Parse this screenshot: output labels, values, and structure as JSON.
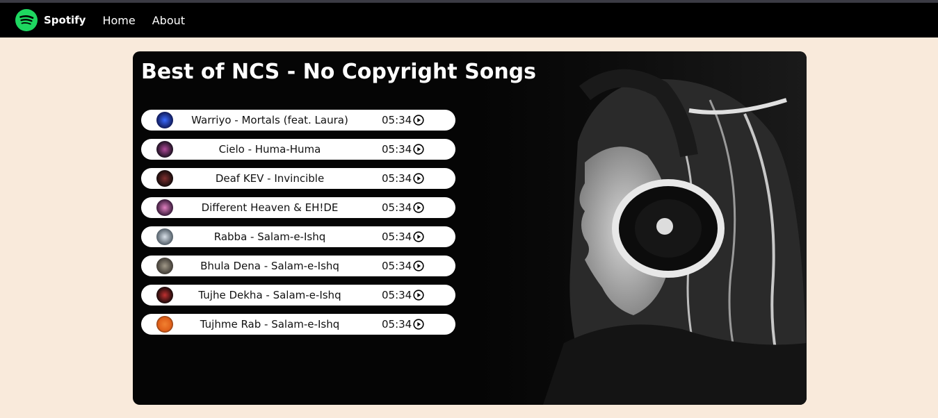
{
  "nav": {
    "brand": "Spotify",
    "links": [
      "Home",
      "About"
    ],
    "accent": "#1ed760",
    "logo_icon": "spotify-logo-icon"
  },
  "main": {
    "title": "Best of NCS - No Copyright Songs",
    "songs": [
      {
        "name": "Warriyo - Mortals (feat. Laura)",
        "duration": "05:34",
        "cover_color": "#1c2c8c"
      },
      {
        "name": "Cielo - Huma-Huma",
        "duration": "05:34",
        "cover_color": "#3a2240"
      },
      {
        "name": "Deaf KEV - Invincible",
        "duration": "05:34",
        "cover_color": "#2a1a1a"
      },
      {
        "name": "Different Heaven & EH!DE",
        "duration": "05:34",
        "cover_color": "#a0406a"
      },
      {
        "name": "Rabba - Salam-e-Ishq",
        "duration": "05:34",
        "cover_color": "#9aa6b0"
      },
      {
        "name": "Bhula Dena - Salam-e-Ishq",
        "duration": "05:34",
        "cover_color": "#6a6258"
      },
      {
        "name": "Tujhe Dekha - Salam-e-Ishq",
        "duration": "05:34",
        "cover_color": "#7a1e1e"
      },
      {
        "name": "Tujhme Rab - Salam-e-Ishq",
        "duration": "05:34",
        "cover_color": "#e0601a"
      }
    ],
    "play_icon": "play-circle-icon"
  },
  "colors": {
    "page_bg": "#f9eadb",
    "nav_bg": "#000000",
    "card_bg": "#050505"
  }
}
